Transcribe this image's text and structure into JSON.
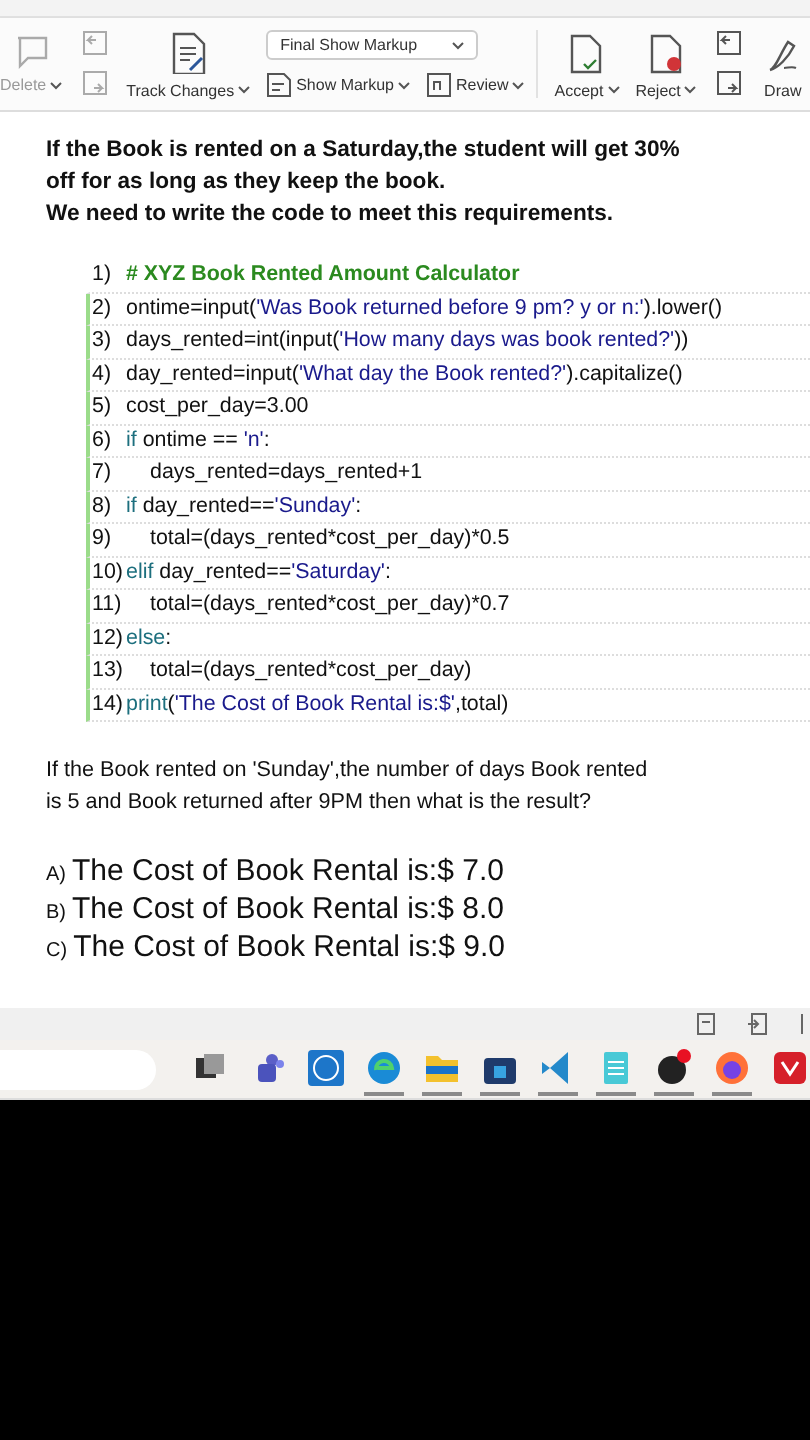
{
  "ribbon": {
    "items": [
      {
        "kind": "small",
        "label": "Delete",
        "caret": true,
        "disabled": true
      },
      {
        "kind": "pair",
        "disabled": true
      },
      {
        "kind": "large",
        "label": "Track Changes",
        "caret": true,
        "disabled": false
      },
      {
        "kind": "markup",
        "select": "Final Show Markup",
        "show": "Show Markup",
        "review": "Review"
      },
      {
        "kind": "large",
        "label": "Accept",
        "caret": true,
        "disabled": false
      },
      {
        "kind": "large",
        "label": "Reject",
        "caret": true,
        "disabled": false
      },
      {
        "kind": "pair",
        "disabled": false
      },
      {
        "kind": "large",
        "label": "Draw",
        "caret": false,
        "disabled": false
      }
    ]
  },
  "document": {
    "paragraphs": [
      "If the Book is rented on a Saturday,the student will get 30% off for as long as they keep the book.",
      "We need to write the code to meet this requirements."
    ],
    "code": [
      {
        "number": "1)",
        "marked": false,
        "indented": false,
        "segments": [
          {
            "kind": "comment",
            "text": "# XYZ Book Rented Amount Calculator"
          }
        ]
      },
      {
        "number": "2)",
        "marked": true,
        "indented": false,
        "segments": [
          {
            "kind": "plain",
            "text": "ontime=input("
          },
          {
            "kind": "string",
            "text": "'Was Book returned before 9 pm? y or n:'"
          },
          {
            "kind": "plain",
            "text": ").lower()"
          }
        ]
      },
      {
        "number": "3)",
        "marked": true,
        "indented": false,
        "segments": [
          {
            "kind": "plain",
            "text": "days_rented=int(input("
          },
          {
            "kind": "string",
            "text": "'How many days was book rented?'"
          },
          {
            "kind": "plain",
            "text": "))"
          }
        ]
      },
      {
        "number": "4)",
        "marked": true,
        "indented": false,
        "segments": [
          {
            "kind": "plain",
            "text": "day_rented=input("
          },
          {
            "kind": "string",
            "text": "'What day the Book rented?'"
          },
          {
            "kind": "plain",
            "text": ").capitalize()"
          }
        ]
      },
      {
        "number": "5)",
        "marked": true,
        "indented": false,
        "segments": [
          {
            "kind": "plain",
            "text": "cost_per_day=3.00"
          }
        ]
      },
      {
        "number": "6)",
        "marked": true,
        "indented": false,
        "segments": [
          {
            "kind": "keyword",
            "text": "if"
          },
          {
            "kind": "plain",
            "text": " ontime == "
          },
          {
            "kind": "string",
            "text": "'n'"
          },
          {
            "kind": "plain",
            "text": ":"
          }
        ]
      },
      {
        "number": "7)",
        "marked": true,
        "indented": true,
        "segments": [
          {
            "kind": "plain",
            "text": "days_rented=days_rented+1"
          }
        ]
      },
      {
        "number": "8)",
        "marked": true,
        "indented": false,
        "segments": [
          {
            "kind": "keyword",
            "text": "if"
          },
          {
            "kind": "plain",
            "text": " day_rented=="
          },
          {
            "kind": "string",
            "text": "'Sunday'"
          },
          {
            "kind": "plain",
            "text": ":"
          }
        ]
      },
      {
        "number": "9)",
        "marked": true,
        "indented": true,
        "segments": [
          {
            "kind": "plain",
            "text": "total=(days_rented*cost_per_day)*0.5"
          }
        ]
      },
      {
        "number": "10)",
        "marked": true,
        "indented": false,
        "segments": [
          {
            "kind": "keyword",
            "text": "elif"
          },
          {
            "kind": "plain",
            "text": " day_rented=="
          },
          {
            "kind": "string",
            "text": "'Saturday'"
          },
          {
            "kind": "plain",
            "text": ":"
          }
        ]
      },
      {
        "number": "11)",
        "marked": true,
        "indented": true,
        "segments": [
          {
            "kind": "plain",
            "text": "total=(days_rented*cost_per_day)*0.7"
          }
        ]
      },
      {
        "number": "12)",
        "marked": true,
        "indented": false,
        "segments": [
          {
            "kind": "keyword",
            "text": "else"
          },
          {
            "kind": "plain",
            "text": ":"
          }
        ]
      },
      {
        "number": "13)",
        "marked": true,
        "indented": true,
        "segments": [
          {
            "kind": "plain",
            "text": "total=(days_rented*cost_per_day)"
          }
        ]
      },
      {
        "number": "14)",
        "marked": true,
        "indented": false,
        "segments": [
          {
            "kind": "keyword",
            "text": "print"
          },
          {
            "kind": "plain",
            "text": "("
          },
          {
            "kind": "string",
            "text": "'The Cost of Book Rental is:$'"
          },
          {
            "kind": "plain",
            "text": ",total)"
          }
        ]
      }
    ],
    "question": "If the Book rented on 'Sunday',the number of days Book rented is 5 and Book returned after 9PM then what is the result?",
    "answers": [
      {
        "letter": "A)",
        "text": "The Cost of Book Rental is:$ 7.0"
      },
      {
        "letter": "B)",
        "text": "The Cost of Book Rental is:$ 8.0"
      },
      {
        "letter": "C)",
        "text": "The Cost of Book Rental is:$ 9.0"
      }
    ]
  },
  "taskbar": {
    "apps": [
      {
        "kind": "taskview",
        "running": false
      },
      {
        "kind": "teams",
        "running": false
      },
      {
        "kind": "dell",
        "running": false
      },
      {
        "kind": "edge",
        "running": true
      },
      {
        "kind": "files",
        "running": true
      },
      {
        "kind": "store",
        "running": true
      },
      {
        "kind": "vscode",
        "running": true
      },
      {
        "kind": "notepad",
        "running": true
      },
      {
        "kind": "obs",
        "running": true
      },
      {
        "kind": "firefox",
        "running": true
      },
      {
        "kind": "redapp",
        "running": false
      }
    ]
  }
}
